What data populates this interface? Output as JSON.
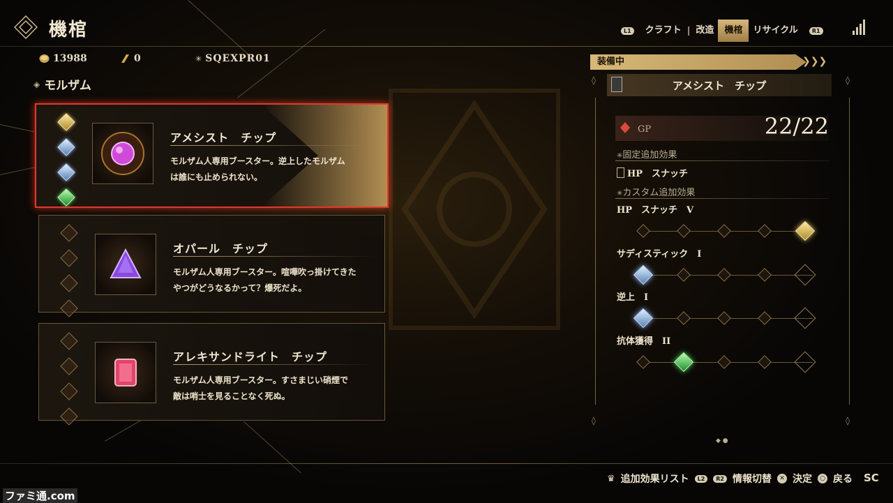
{
  "header": {
    "title": "機棺",
    "tabs": [
      {
        "label": "クラフト",
        "active": false
      },
      {
        "label": "改造",
        "active": false
      },
      {
        "label": "機棺",
        "active": true
      },
      {
        "label": "リサイクル",
        "active": false
      }
    ],
    "btn_left": "L1",
    "btn_right": "R1",
    "tab_separator": "|"
  },
  "currency": {
    "gold": "13988",
    "points": "0",
    "player_id": "SQEXPR01"
  },
  "category": "モルザム",
  "chips": [
    {
      "name": "アメシスト　チップ",
      "desc_line1": "モルザム人専用ブースター。逆上したモルザム",
      "desc_line2": "は誰にも止められない。",
      "selected": true,
      "slots": [
        "gold",
        "blue",
        "blue",
        "green"
      ],
      "gem_color": "#d04ad8"
    },
    {
      "name": "オパール　チップ",
      "desc_line1": "モルザム人専用ブースター。喧嘩吹っ掛けてきた",
      "desc_line2": "やつがどうなるかって？爆死だよ。",
      "selected": false,
      "slots": [
        "empty",
        "empty",
        "empty",
        "empty"
      ],
      "gem_color": "#8a4ae0"
    },
    {
      "name": "アレキサンドライト　チップ",
      "desc_line1": "モルザム人専用ブースター。すさまじい硝煙で",
      "desc_line2": "敵は哨士を見ることなく死ぬ。",
      "selected": false,
      "slots": [
        "empty",
        "empty",
        "empty",
        "empty"
      ],
      "gem_color": "#e0456a"
    }
  ],
  "detail": {
    "equipped_label": "装備中",
    "equipped_name": "アメシスト　チップ",
    "gp_label": "GP",
    "gp_value": "22/22",
    "fixed_header": "固定追加効果",
    "fixed_effect": "HP　スナッチ",
    "custom_header": "カスタム追加効果",
    "custom_effects": [
      {
        "name": "HP　スナッチ　V",
        "level": 5,
        "color": "gold"
      },
      {
        "name": "サディスティック　I",
        "level": 1,
        "color": "blue"
      },
      {
        "name": "逆上　I",
        "level": 1,
        "color": "blue"
      },
      {
        "name": "抗体獲得　II",
        "level": 2,
        "color": "green"
      }
    ],
    "page_dots": "◆ ●"
  },
  "footer": {
    "effect_list": "追加効果リスト",
    "btn_l2": "L2",
    "btn_r2": "R2",
    "info_switch": "情報切替",
    "confirm": "決定",
    "back": "戻る",
    "brand_mark": "SC",
    "watermark": "ファミ通.com"
  },
  "colors": {
    "selection": "#e0392a",
    "gold": "#d8b978",
    "text": "#efe4cb"
  }
}
